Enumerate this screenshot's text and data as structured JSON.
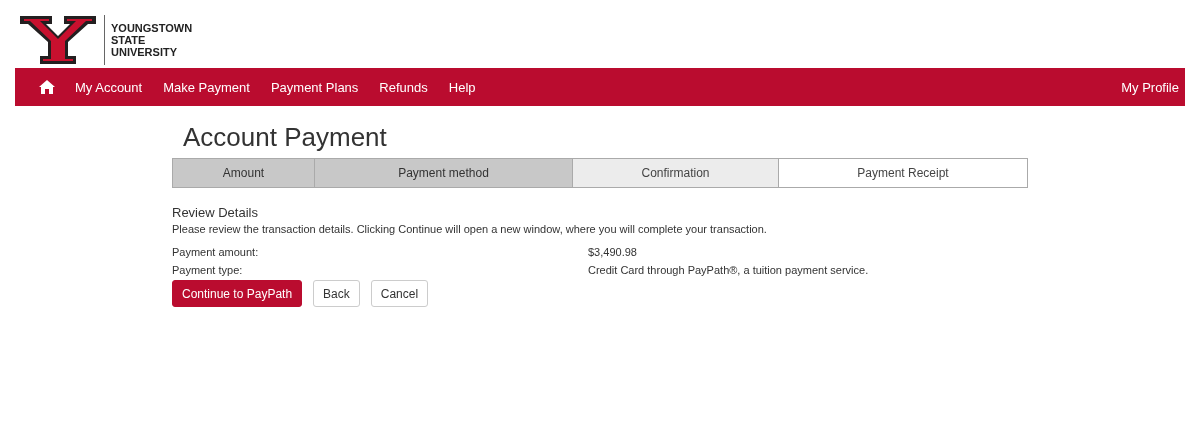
{
  "header": {
    "logo_lines": [
      "YOUNGSTOWN",
      "STATE",
      "UNIVERSITY"
    ]
  },
  "nav": {
    "items": [
      {
        "label": "My Account"
      },
      {
        "label": "Make Payment"
      },
      {
        "label": "Payment Plans"
      },
      {
        "label": "Refunds"
      },
      {
        "label": "Help"
      }
    ],
    "profile": "My Profile"
  },
  "page": {
    "title": "Account Payment",
    "steps": [
      {
        "label": "Amount",
        "completed": true,
        "selected": false
      },
      {
        "label": "Payment method",
        "completed": true,
        "selected": false
      },
      {
        "label": "Confirmation",
        "completed": false,
        "selected": true
      },
      {
        "label": "Payment Receipt",
        "completed": false,
        "selected": false
      }
    ],
    "section_title": "Review Details",
    "instructions": "Please review the transaction details. Clicking Continue will open a new window, where you will complete your transaction.",
    "details": [
      {
        "label": "Payment amount:",
        "value": "$3,490.98"
      },
      {
        "label": "Payment type:",
        "value": "Credit Card through PayPath®, a tuition payment service."
      }
    ],
    "buttons": [
      {
        "label": "Continue to PayPath",
        "kind": "primary"
      },
      {
        "label": "Back",
        "kind": "default"
      },
      {
        "label": "Cancel",
        "kind": "default"
      }
    ]
  }
}
